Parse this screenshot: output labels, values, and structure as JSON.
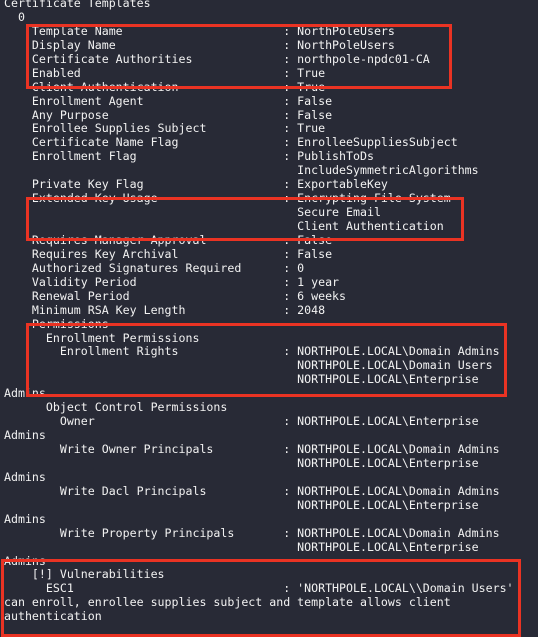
{
  "terminal": {
    "colors": {
      "background": "#282a36",
      "foreground": "#f2f2f2",
      "highlight_box": "#ea3323"
    },
    "lines": [
      "Certificate Templates",
      "  0",
      "    Template Name                       : NorthPoleUsers",
      "    Display Name                        : NorthPoleUsers",
      "    Certificate Authorities             : northpole-npdc01-CA",
      "    Enabled                             : True",
      "    Client Authentication               : True",
      "    Enrollment Agent                    : False",
      "    Any Purpose                         : False",
      "    Enrollee Supplies Subject           : True",
      "    Certificate Name Flag               : EnrolleeSuppliesSubject",
      "    Enrollment Flag                     : PublishToDs",
      "                                          IncludeSymmetricAlgorithms",
      "    Private Key Flag                    : ExportableKey",
      "    Extended Key Usage                  : Encrypting File System",
      "                                          Secure Email",
      "                                          Client Authentication",
      "    Requires Manager Approval           : False",
      "    Requires Key Archival               : False",
      "    Authorized Signatures Required      : 0",
      "    Validity Period                     : 1 year",
      "    Renewal Period                      : 6 weeks",
      "    Minimum RSA Key Length              : 2048",
      "    Permissions",
      "      Enrollment Permissions",
      "        Enrollment Rights               : NORTHPOLE.LOCAL\\Domain Admins",
      "                                          NORTHPOLE.LOCAL\\Domain Users",
      "                                          NORTHPOLE.LOCAL\\Enterprise",
      "Admins",
      "      Object Control Permissions",
      "        Owner                           : NORTHPOLE.LOCAL\\Enterprise",
      "Admins",
      "        Write Owner Principals          : NORTHPOLE.LOCAL\\Domain Admins",
      "                                          NORTHPOLE.LOCAL\\Enterprise",
      "Admins",
      "        Write Dacl Principals           : NORTHPOLE.LOCAL\\Domain Admins",
      "                                          NORTHPOLE.LOCAL\\Enterprise",
      "Admins",
      "        Write Property Principals       : NORTHPOLE.LOCAL\\Domain Admins",
      "                                          NORTHPOLE.LOCAL\\Enterprise",
      "Admins",
      "    [!] Vulnerabilities",
      "      ESC1                              : 'NORTHPOLE.LOCAL\\\\Domain Users'",
      "can enroll, enrollee supplies subject and template allows client",
      "authentication"
    ],
    "highlights": [
      {
        "name": "certificate-identity",
        "from_line": 2,
        "to_line": 5
      },
      {
        "name": "extended-key-usage",
        "from_line": 14,
        "to_line": 16
      },
      {
        "name": "enrollment-permissions",
        "from_line": 23,
        "to_line": 27
      },
      {
        "name": "vulnerabilities",
        "from_line": 40,
        "to_line": 44
      }
    ]
  }
}
